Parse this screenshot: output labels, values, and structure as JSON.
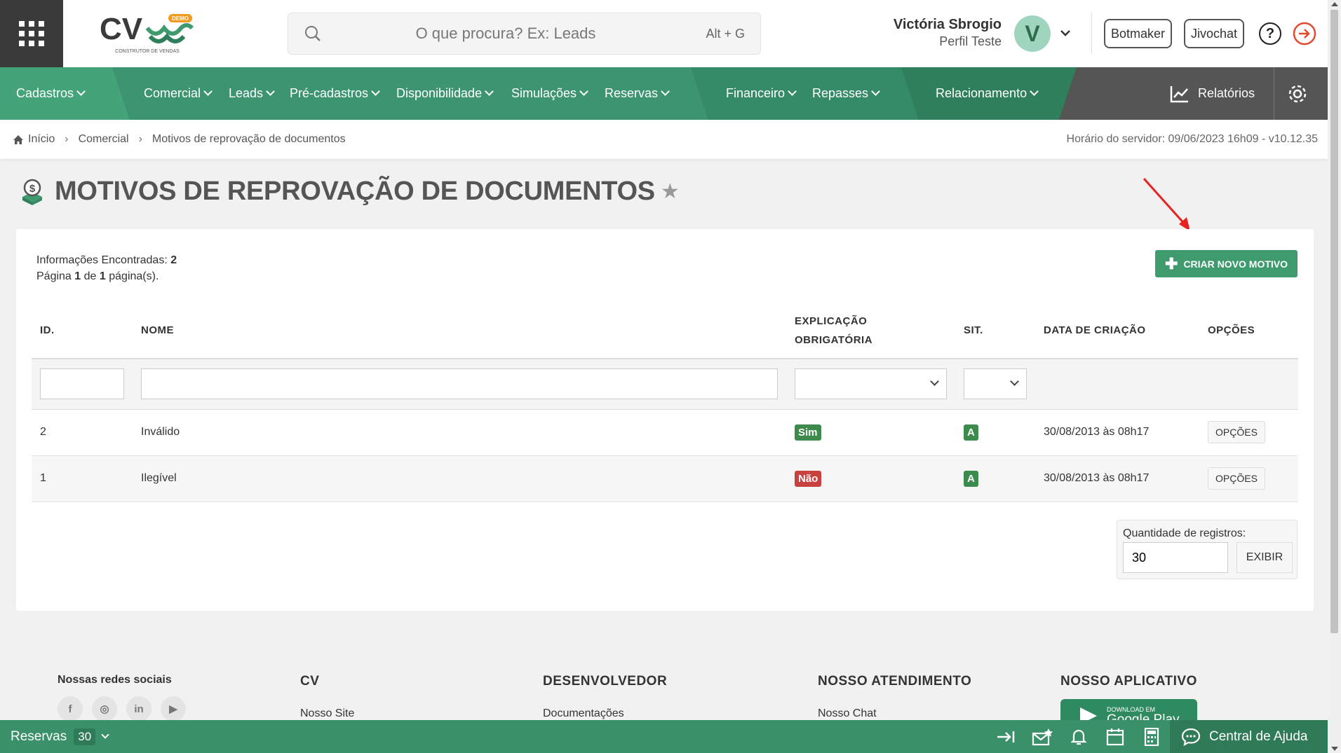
{
  "header": {
    "search_placeholder": "O que procura? Ex: Leads",
    "search_shortcut": "Alt + G",
    "user_name": "Victória Sbrogio",
    "user_role": "Perfil Teste",
    "avatar_initial": "V",
    "botmaker_label": "Botmaker",
    "jivochat_label": "Jivochat",
    "logo_badge": "DEMO",
    "logo_tagline": "CONSTRUTOR DE VENDAS",
    "logo_letters": "CV"
  },
  "nav": {
    "items": [
      "Cadastros",
      "Comercial",
      "Leads",
      "Pré-cadastros",
      "Disponibilidade",
      "Simulações",
      "Reservas",
      "Financeiro",
      "Repasses",
      "Relacionamento"
    ],
    "reports_label": "Relatórios",
    "colors": {
      "green_light": "#45a37a",
      "green_mid": "#3c9471",
      "green_dark": "#2f7f5c",
      "gray": "#555555"
    }
  },
  "breadcrumb": {
    "home": "Início",
    "level1": "Comercial",
    "level2": "Motivos de reprovação de documentos",
    "server_time": "Horário do servidor: 09/06/2023 16h09 - v10.12.35"
  },
  "page": {
    "title": "MOTIVOS DE REPROVAÇÃO DE DOCUMENTOS"
  },
  "results": {
    "found_label": "Informações Encontradas:",
    "found_count": "2",
    "page_prefix": "Página",
    "page_current": "1",
    "page_of": "de",
    "page_total": "1",
    "page_suffix": "página(s)."
  },
  "create_button": "CRIAR NOVO MOTIVO",
  "table": {
    "headers": {
      "id": "ID.",
      "name": "NOME",
      "explanation_line1": "EXPLICAÇÃO",
      "explanation_line2": "OBRIGATÓRIA",
      "status": "SIT.",
      "created": "DATA DE CRIAÇÃO",
      "options": "OPÇÕES"
    },
    "rows": [
      {
        "id": "2",
        "name": "Inválido",
        "explanation": "Sim",
        "status": "A",
        "created": "30/08/2013 às 08h17",
        "options": "OPÇÕES"
      },
      {
        "id": "1",
        "name": "Ilegível",
        "explanation": "Não",
        "status": "A",
        "created": "30/08/2013 às 08h17",
        "options": "OPÇÕES"
      }
    ]
  },
  "records": {
    "label": "Quantidade de registros:",
    "value": "30",
    "button": "EXIBIR"
  },
  "footer": {
    "social_title": "Nossas redes sociais",
    "social_icons": [
      "facebook-icon",
      "instagram-icon",
      "linkedin-icon",
      "youtube-icon"
    ],
    "cv_title": "CV",
    "cv_link": "Nosso Site",
    "dev_title": "DESENVOLVEDOR",
    "dev_link": "Documentações",
    "support_title": "NOSSO ATENDIMENTO",
    "support_link": "Nosso Chat",
    "app_title": "NOSSO APLICATIVO",
    "gplay_small": "DOWNLOAD EM",
    "gplay_big": "Google Play"
  },
  "bottombar": {
    "reservations_label": "Reservas",
    "reservations_count": "30",
    "help_center": "Central de Ajuda"
  }
}
